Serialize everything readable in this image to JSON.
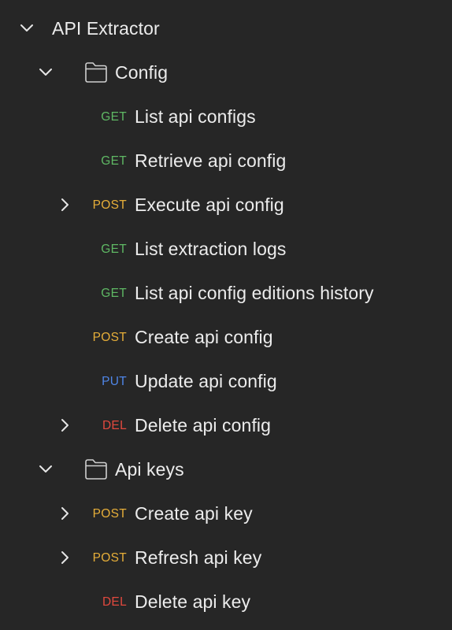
{
  "collection": {
    "title": "API Extractor",
    "expanded": true
  },
  "folders": [
    {
      "name": "Config",
      "expanded": true,
      "icon": "folder-icon",
      "requests": [
        {
          "method": "GET",
          "label": "List api configs",
          "has_children": false
        },
        {
          "method": "GET",
          "label": "Retrieve api config",
          "has_children": false
        },
        {
          "method": "POST",
          "label": "Execute api config",
          "has_children": true
        },
        {
          "method": "GET",
          "label": "List extraction logs",
          "has_children": false
        },
        {
          "method": "GET",
          "label": "List api config editions history",
          "has_children": false
        },
        {
          "method": "POST",
          "label": "Create api config",
          "has_children": false
        },
        {
          "method": "PUT",
          "label": "Update api config",
          "has_children": false
        },
        {
          "method": "DEL",
          "label": "Delete api config",
          "has_children": true
        }
      ]
    },
    {
      "name": "Api keys",
      "expanded": true,
      "icon": "folder-icon",
      "requests": [
        {
          "method": "POST",
          "label": "Create api key",
          "has_children": true
        },
        {
          "method": "POST",
          "label": "Refresh api key",
          "has_children": true
        },
        {
          "method": "DEL",
          "label": "Delete api key",
          "has_children": false
        }
      ]
    }
  ],
  "colors": {
    "background": "#262626",
    "text": "#ececec",
    "GET": "#5fb864",
    "POST": "#e6ae39",
    "PUT": "#4f86e8",
    "DEL": "#e2493e"
  }
}
